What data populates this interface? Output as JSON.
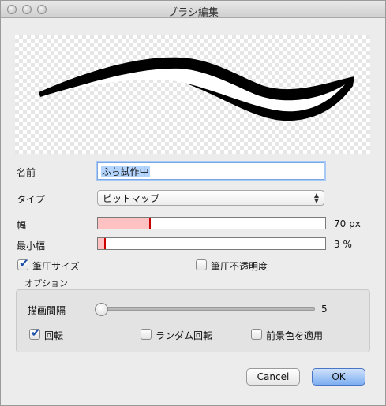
{
  "window": {
    "title": "ブラシ編集"
  },
  "form": {
    "name_label": "名前",
    "name_value": "ふち試作中",
    "type_label": "タイプ",
    "type_value": "ビットマップ",
    "width_label": "幅",
    "width_value": "70 px",
    "width_fraction": 0.23,
    "minwidth_label": "最小幅",
    "minwidth_value": "3 %",
    "minwidth_fraction": 0.03,
    "pressure_size_label": "筆圧サイズ",
    "pressure_size_checked": true,
    "pressure_opacity_label": "筆圧不透明度",
    "pressure_opacity_checked": false
  },
  "options": {
    "title": "オプション",
    "interval_label": "描画間隔",
    "interval_value": "5",
    "interval_fraction": 0.0,
    "rotate_label": "回転",
    "rotate_checked": true,
    "random_rotate_label": "ランダム回転",
    "random_rotate_checked": false,
    "fg_color_label": "前景色を適用",
    "fg_color_checked": false
  },
  "buttons": {
    "cancel": "Cancel",
    "ok": "OK"
  },
  "colors": {
    "slider_fill": "#ffc2c2",
    "slider_mark": "#cc0000",
    "ok_button": "#7eaef1"
  }
}
